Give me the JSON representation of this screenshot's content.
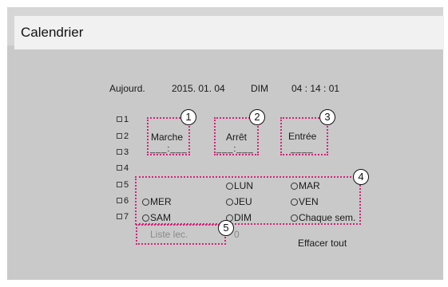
{
  "window": {
    "title": "Calendrier"
  },
  "today": {
    "label": "Aujourd.",
    "date": "2015. 01. 04",
    "day": "DIM",
    "time": "04 : 14 : 01"
  },
  "slots": [
    "1",
    "2",
    "3",
    "4",
    "5",
    "6",
    "7"
  ],
  "columns": {
    "start": "Marche",
    "stop": "Arrêt",
    "input": "Entrée"
  },
  "time_placeholder": "___:___",
  "input_placeholder": "____",
  "days": {
    "lun": "LUN",
    "mar": "MAR",
    "mer": "MER",
    "jeu": "JEU",
    "ven": "VEN",
    "sam": "SAM",
    "dim": "DIM",
    "weekly": "Chaque sem."
  },
  "playlist": {
    "label": "Liste lec.",
    "value": "0"
  },
  "clear_all": "Effacer tout",
  "callouts": [
    "1",
    "2",
    "3",
    "4",
    "5"
  ],
  "colors": {
    "callout_border": "#d4247a",
    "panel": "#c9c9c9",
    "titlebar": "#f1f1f1"
  }
}
